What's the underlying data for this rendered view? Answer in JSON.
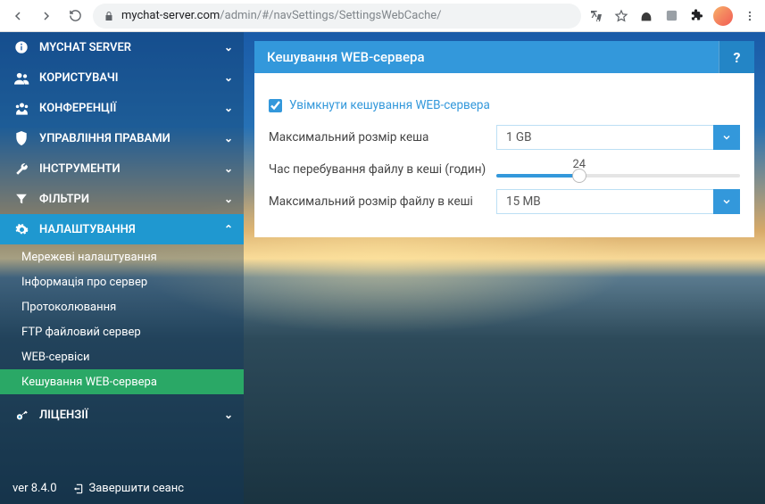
{
  "browser": {
    "url_base": "mychat-server.com",
    "url_path": "/admin/#/navSettings/SettingsWebCache/"
  },
  "sidebar": {
    "items": [
      {
        "label": "MYCHAT SERVER",
        "icon": "info-icon"
      },
      {
        "label": "КОРИСТУВАЧІ",
        "icon": "users-icon"
      },
      {
        "label": "КОНФЕРЕНЦІЇ",
        "icon": "group-icon"
      },
      {
        "label": "УПРАВЛІННЯ ПРАВАМИ",
        "icon": "shield-icon"
      },
      {
        "label": "ІНСТРУМЕНТИ",
        "icon": "wrench-icon"
      },
      {
        "label": "ФІЛЬТРИ",
        "icon": "funnel-icon"
      },
      {
        "label": "НАЛАШТУВАННЯ",
        "icon": "gear-icon",
        "active": true
      },
      {
        "label": "ЛІЦЕНЗІЇ",
        "icon": "key-icon"
      }
    ],
    "subitems": [
      "Мережеві налаштування",
      "Інформація про сервер",
      "Протоколювання",
      "FTP файловий сервер",
      "WEB-сервіси",
      "Кешування WEB-сервера"
    ],
    "version": "ver 8.4.0",
    "logout": "Завершити сеанс"
  },
  "panel": {
    "title": "Кешування WEB-сервера",
    "help": "?",
    "enable_label": "Увімкнути кешування WEB-сервера",
    "enable_checked": true,
    "max_cache_label": "Максимальний розмір кеша",
    "max_cache_value": "1 GB",
    "file_time_label": "Час перебування файлу в кеші (годин)",
    "file_time_value": "24",
    "file_time_pct": 34,
    "max_file_label": "Максимальний розмір файлу в кеші",
    "max_file_value": "15 MB"
  }
}
